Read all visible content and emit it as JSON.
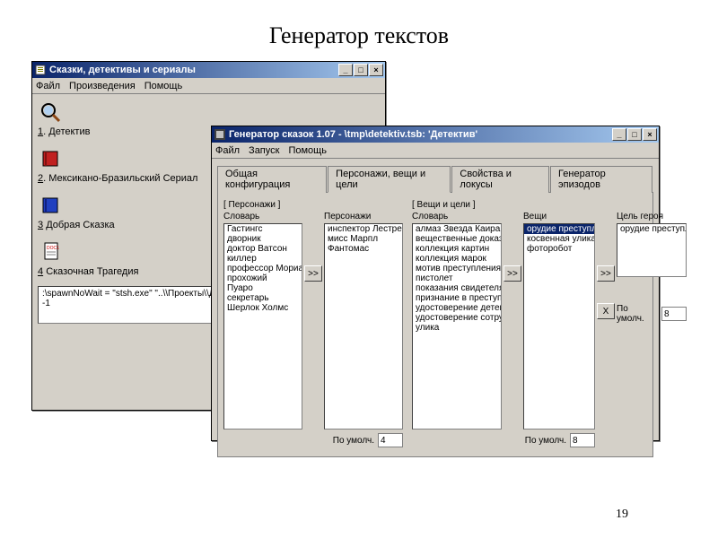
{
  "slide": {
    "title": "Генератор текстов",
    "page": "19"
  },
  "win1": {
    "title": "Сказки, детективы и сериалы",
    "menu": [
      "Файл",
      "Произведения",
      "Помощь"
    ],
    "items": [
      {
        "num": "1",
        "label": "Детектив"
      },
      {
        "num": "2",
        "label": "Мексикано-Бразильский Сериал"
      },
      {
        "num": "3",
        "label": "Добрая Сказка"
      },
      {
        "num": "4",
        "label": "Сказочная Трагедия"
      }
    ],
    "status_line1": ":\\spawnNoWait = \"stsh.exe\" \"..\\\\Проекты\\\\Детектив.xp…",
    "status_line2": "-1"
  },
  "win2": {
    "title": "Генератор сказок 1.07 - \\tmp\\detektiv.tsb:   'Детектив'",
    "menu": [
      "Файл",
      "Запуск",
      "Помощь"
    ],
    "tabs": [
      "Общая конфигурация",
      "Персонажи, вещи и цели",
      "Свойства и локусы",
      "Генератор эпизодов"
    ],
    "active_tab": 1,
    "groups": {
      "personazhi_head": "[ Персонажи ]",
      "slovar_label": "Словарь",
      "personazhi_label": "Персонажи",
      "veshchi_head": "[ Вещи и цели ]",
      "veshchi_label": "Вещи",
      "tsel_label": "Цель героя",
      "default_label": "По умолч.",
      "slovar1": [
        "Гастингс",
        "дворник",
        "доктор Ватсон",
        "киллер",
        "профессор Мориарти",
        "прохожий",
        "Пуаро",
        "секретарь",
        "Шерлок Холмс"
      ],
      "personazhi": [
        "инспектор Лестрейд",
        "мисс Марпл",
        "Фантомас"
      ],
      "slovar2": [
        "алмаз Звезда Каира",
        "вещественные доказательства",
        "коллекция картин",
        "коллекция марок",
        "мотив преступления",
        "пистолет",
        "показания свидетеля",
        "признание в преступлении",
        "удостоверение детектива",
        "удостоверение сотрудника",
        "улика"
      ],
      "veshchi": [
        "орудие преступления",
        "косвенная улика",
        "фоторобот"
      ],
      "tsel": [
        "орудие преступления"
      ],
      "default1": "4",
      "default2": "8",
      "default3": "8"
    },
    "btn_add": ">>",
    "btn_del": "X"
  }
}
